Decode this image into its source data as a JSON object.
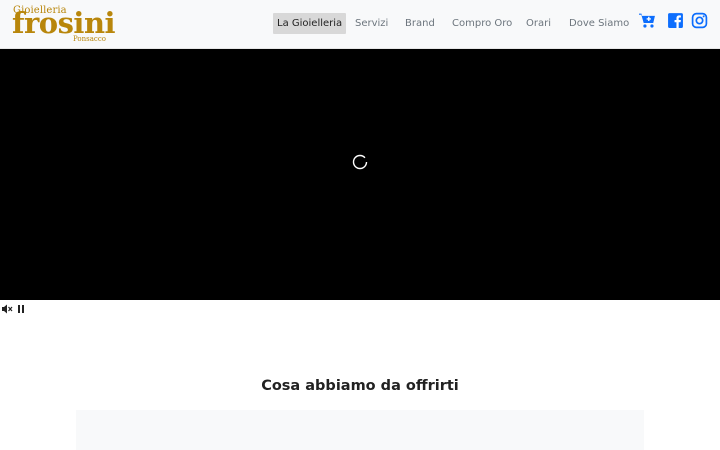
{
  "brand": {
    "tagline": "Gioielleria",
    "name": "frosini",
    "location": "Ponsacco",
    "color": "#b8860b"
  },
  "nav": {
    "items": [
      {
        "label": "La Gioielleria",
        "active": true
      },
      {
        "label": "Servizi",
        "active": false
      },
      {
        "label": "Brand",
        "active": false
      },
      {
        "label": "Compro Oro",
        "active": false
      },
      {
        "label": "Orari",
        "active": false
      },
      {
        "label": "Dove Siamo",
        "active": false
      }
    ],
    "icons": [
      "cart-icon",
      "facebook-icon",
      "instagram-icon"
    ],
    "icon_color": "#0d6efd"
  },
  "video": {
    "state": "loading",
    "controls": [
      "mute-icon",
      "pause-icon"
    ]
  },
  "section": {
    "title": "Cosa abbiamo da offrirti"
  }
}
